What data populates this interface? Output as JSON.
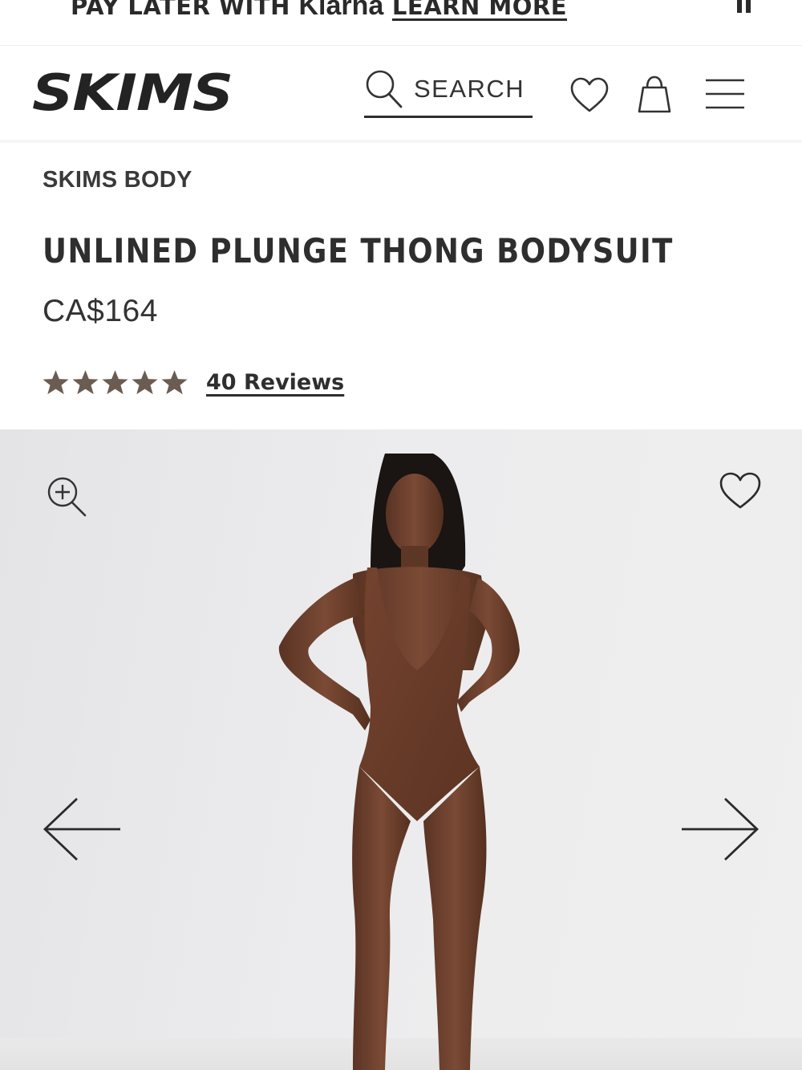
{
  "promo": {
    "prefix": "PAY LATER WITH ",
    "brand": "Klarna",
    "link": "LEARN MORE"
  },
  "header": {
    "logo_text": "SKIMS",
    "search_label": "SEARCH",
    "icons": [
      "search-icon",
      "heart-icon",
      "shopping-bag-icon",
      "hamburger-menu-icon"
    ]
  },
  "product": {
    "brand": "SKIMS BODY",
    "title": "UNLINED PLUNGE THONG BODYSUIT",
    "price": "CA$164",
    "rating": 5,
    "rating_max": 5,
    "reviews_label": "40 Reviews"
  },
  "gallery": {
    "icons": [
      "zoom-in-icon",
      "heart-icon",
      "arrow-left-icon",
      "arrow-right-icon"
    ]
  },
  "colors": {
    "text": "#2b2b2b",
    "star": "#6b5c52",
    "bodysuit": "#6a3b2c",
    "background": "#ffffff",
    "gallery_bg": "#ebebec"
  }
}
